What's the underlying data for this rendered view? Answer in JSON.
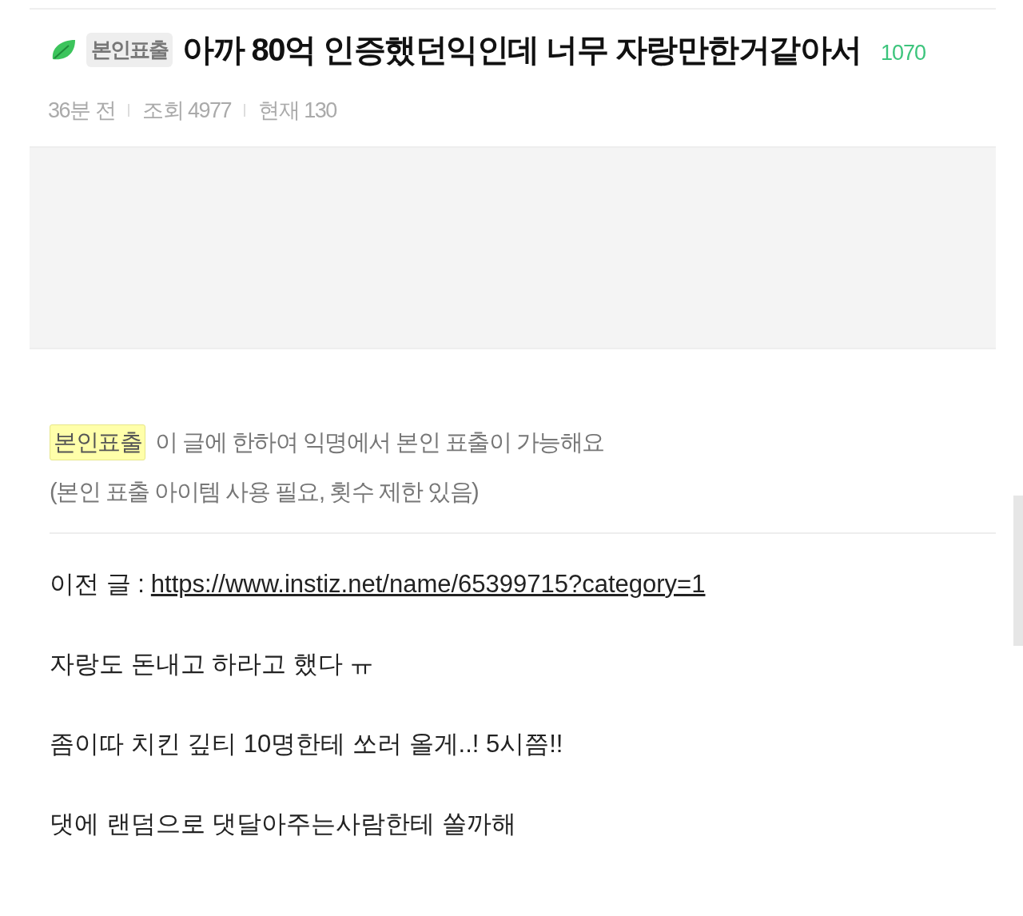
{
  "post": {
    "badge": "본인표출",
    "title": "아까 80억 인증했던익인데 너무 자랑만한거같아서",
    "comment_count": "1070",
    "meta": [
      "36분 전",
      "조회 4977",
      "현재 130"
    ]
  },
  "notice": {
    "tag": "본인표출",
    "text": "이 글에 한하여 익명에서 본인 표출이 가능해요",
    "subtext": "(본인 표출 아이템 사용 필요, 횟수 제한 있음)"
  },
  "body": [
    {
      "kind": "link",
      "label": "이전 글 :",
      "url": "https://www.instiz.net/name/65399715?category=1"
    },
    {
      "kind": "text",
      "text": "자랑도 돈내고 하라고 했다 ㅠ"
    },
    {
      "kind": "text",
      "text": "좀이따 치킨 깊티 10명한테 쏘러 올게..! 5시쯤!!"
    },
    {
      "kind": "text",
      "text": "댓에 랜덤으로 댓달아주는사람한테 쏠까해"
    }
  ]
}
